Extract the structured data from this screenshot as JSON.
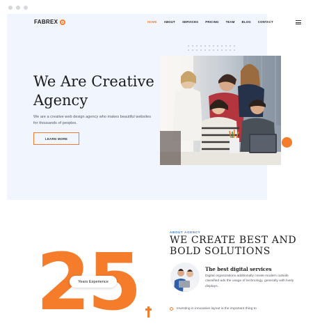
{
  "brand": {
    "name": "FABREX",
    "accent": "#f57c2a"
  },
  "nav": {
    "items": [
      {
        "label": "HOME",
        "active": true
      },
      {
        "label": "ABOUT",
        "active": false
      },
      {
        "label": "SERVICES",
        "active": false
      },
      {
        "label": "PRICING",
        "active": false
      },
      {
        "label": "TEAM",
        "active": false
      },
      {
        "label": "BLOG",
        "active": false
      },
      {
        "label": "CONTACT",
        "active": false
      }
    ],
    "menu_icon": "hamburger-menu-icon"
  },
  "hero": {
    "title": "We Are Creative Agency",
    "description": "We are a creative web design agency who makes beautiful websites for thousands of peoples.",
    "button_label": "LEARN MORE",
    "background": "#f1f5fd"
  },
  "about": {
    "eyebrow": "ABOUT AGENCY",
    "title": "WE CREATE BEST AND BOLD SOLUTIONS",
    "eyebrow_color": "#3f7be0",
    "experience": {
      "number": "25",
      "label": "Years Experience"
    },
    "service": {
      "title": "The best digital services",
      "description": "Digital organizations additionally create modern outside classified ads the usage of technology, generally with lively displays."
    },
    "bullet_text": "Investing in innovative layout is the important thing to"
  }
}
